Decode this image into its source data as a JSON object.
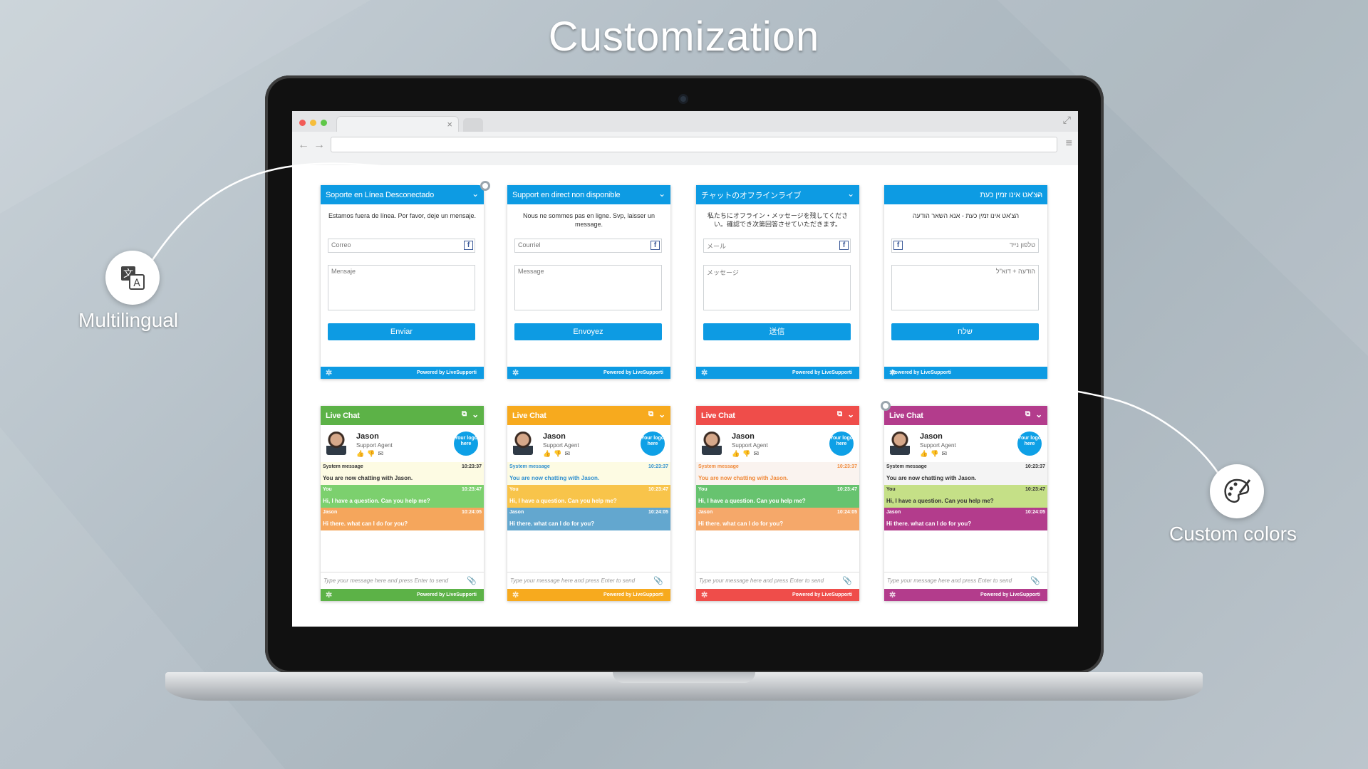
{
  "page": {
    "title": "Customization"
  },
  "callouts": {
    "multilingual": {
      "label": "Multilingual",
      "icon": "translate-icon"
    },
    "custom_colors": {
      "label": "Custom colors",
      "icon": "palette-icon"
    }
  },
  "offline_widgets": [
    {
      "header": "Soporte en Línea Desconectado",
      "message": "Estamos fuera de línea. Por favor, deje un mensaje.",
      "email_placeholder": "Correo",
      "message_placeholder": "Mensaje",
      "button": "Enviar",
      "footer": "Powered by LiveSupporti",
      "rtl": false
    },
    {
      "header": "Support en direct non disponible",
      "message": "Nous ne sommes pas en ligne. Svp, laisser un message.",
      "email_placeholder": "Courriel",
      "message_placeholder": "Message",
      "button": "Envoyez",
      "footer": "Powered by LiveSupporti",
      "rtl": false
    },
    {
      "header": "チャットのオフラインライブ",
      "message": "私たちにオフライン・メッセージを残してください。確認でき次第回答させていただきます。",
      "email_placeholder": "メール",
      "message_placeholder": "メッセージ",
      "button": "送信",
      "footer": "Powered by LiveSupporti",
      "rtl": false
    },
    {
      "header": "הצ'אט אינו זמין כעת",
      "message": "הצ'אט אינו זמין כעת - אנא השאר הודעה",
      "email_placeholder": "טלפון נייד",
      "message_placeholder": "הודעה + דוא\"ל",
      "button": "שלח",
      "footer": "Powered by LiveSupporti",
      "rtl": true
    }
  ],
  "chat_widgets": [
    {
      "header": "Live Chat",
      "agent_name": "Jason",
      "agent_role": "Support Agent",
      "logo": "Your logo here",
      "composer": "Type your message here and press Enter to send",
      "footer": "Powered by LiveSupporti",
      "messages": [
        {
          "who": "System message",
          "time": "10:23:37",
          "text": "You are now chatting with Jason."
        },
        {
          "who": "You",
          "time": "10:23:47",
          "text": "Hi, I have a question. Can you help me?"
        },
        {
          "who": "Jason",
          "time": "10:24:05",
          "text": "Hi there. what can I do for you?"
        }
      ]
    },
    {
      "header": "Live Chat",
      "agent_name": "Jason",
      "agent_role": "Support Agent",
      "logo": "Your logo here",
      "composer": "Type your message here and press Enter to send",
      "footer": "Powered by LiveSupporti",
      "messages": [
        {
          "who": "System message",
          "time": "10:23:37",
          "text": "You are now chatting with Jason."
        },
        {
          "who": "You",
          "time": "10:23:47",
          "text": "Hi, I have a question. Can you help me?"
        },
        {
          "who": "Jason",
          "time": "10:24:05",
          "text": "Hi there. what can I do for you?"
        }
      ]
    },
    {
      "header": "Live Chat",
      "agent_name": "Jason",
      "agent_role": "Support Agent",
      "logo": "Your logo here",
      "composer": "Type your message here and press Enter to send",
      "footer": "Powered by LiveSupporti",
      "messages": [
        {
          "who": "System message",
          "time": "10:23:37",
          "text": "You are now chatting with Jason."
        },
        {
          "who": "You",
          "time": "10:23:47",
          "text": "Hi, I have a question. Can you help me?"
        },
        {
          "who": "Jason",
          "time": "10:24:05",
          "text": "Hi there. what can I do for you?"
        }
      ]
    },
    {
      "header": "Live Chat",
      "agent_name": "Jason",
      "agent_role": "Support Agent",
      "logo": "Your logo here",
      "composer": "Type your message here and press Enter to send",
      "footer": "Powered by LiveSupporti",
      "messages": [
        {
          "who": "System message",
          "time": "10:23:37",
          "text": "You are now chatting with Jason."
        },
        {
          "who": "You",
          "time": "10:23:47",
          "text": "Hi, I have a question. Can you help me?"
        },
        {
          "who": "Jason",
          "time": "10:24:05",
          "text": "Hi there. what can I do for you?"
        }
      ]
    }
  ],
  "colors": {
    "offline_accent": "#0d9be3",
    "themes": [
      {
        "head": "#5cb247",
        "sys_bg": "#fdfbe3",
        "sys_fg": "#333333",
        "you_bg": "#7cd06e",
        "you_fg": "#ffffff",
        "agent_bg": "#f5a65c",
        "agent_fg": "#ffffff"
      },
      {
        "head": "#f7aa1e",
        "sys_bg": "#fdfbe3",
        "sys_fg": "#2f8fcf",
        "you_bg": "#f8c44a",
        "you_fg": "#ffffff",
        "agent_bg": "#63a7cf",
        "agent_fg": "#ffffff"
      },
      {
        "head": "#ef4d4a",
        "sys_bg": "#faf3ef",
        "sys_fg": "#f08a3a",
        "you_bg": "#67c36f",
        "you_fg": "#ffffff",
        "agent_bg": "#f5a86a",
        "agent_fg": "#ffffff"
      },
      {
        "head": "#b33c8c",
        "sys_bg": "#f4f4f4",
        "sys_fg": "#333333",
        "you_bg": "#c5e087",
        "you_fg": "#333333",
        "agent_bg": "#b33c8c",
        "agent_fg": "#ffffff"
      }
    ]
  }
}
